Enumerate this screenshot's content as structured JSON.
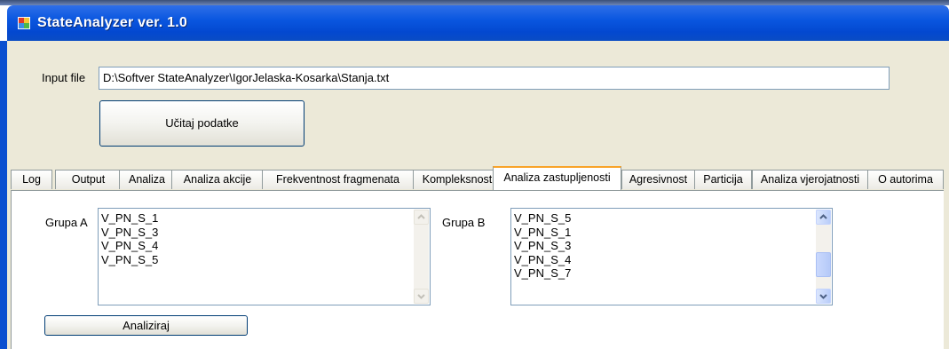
{
  "window": {
    "title": "StateAnalyzer ver. 1.0"
  },
  "input": {
    "label": "Input file",
    "value": "D:\\Softver StateAnalyzer\\IgorJelaska-Kosarka\\Stanja.txt"
  },
  "load_button": "Učitaj podatke",
  "tabs": [
    {
      "label": "Log"
    },
    {
      "label": "Output"
    },
    {
      "label": "Analiza"
    },
    {
      "label": "Analiza akcije"
    },
    {
      "label": "Frekventnost fragmenata"
    },
    {
      "label": "Kompleksnost"
    },
    {
      "label": "Analiza zastupljenosti",
      "active": true
    },
    {
      "label": "Agresivnost"
    },
    {
      "label": "Particija"
    },
    {
      "label": "Analiza vjerojatnosti"
    },
    {
      "label": "O autorima"
    }
  ],
  "group_a": {
    "label": "Grupa A",
    "items": [
      "V_PN_S_1",
      "V_PN_S_3",
      "V_PN_S_4",
      "V_PN_S_5"
    ]
  },
  "group_b": {
    "label": "Grupa B",
    "items": [
      "V_PN_S_5",
      "V_PN_S_1",
      "V_PN_S_3",
      "V_PN_S_4",
      "V_PN_S_7"
    ]
  },
  "analyze_button": "Analiziraj"
}
